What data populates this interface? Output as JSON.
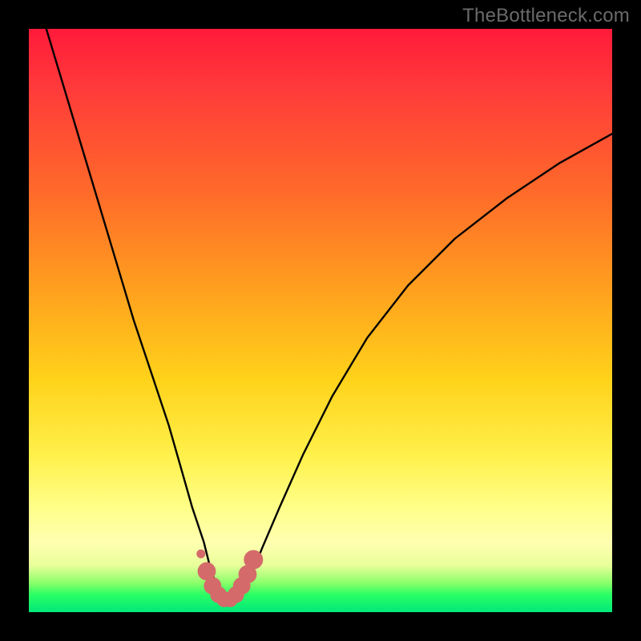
{
  "watermark": "TheBottleneck.com",
  "chart_data": {
    "type": "line",
    "title": "",
    "xlabel": "",
    "ylabel": "",
    "xlim": [
      0,
      100
    ],
    "ylim": [
      0,
      100
    ],
    "grid": false,
    "legend": false,
    "series": [
      {
        "name": "bottleneck-curve",
        "color": "#000000",
        "x": [
          3,
          6,
          9,
          12,
          15,
          18,
          21,
          24,
          26,
          28,
          30,
          31,
          32,
          33,
          34,
          35,
          36,
          38,
          40,
          43,
          47,
          52,
          58,
          65,
          73,
          82,
          91,
          100
        ],
        "values": [
          100,
          90,
          80,
          70,
          60,
          50,
          41,
          32,
          25,
          18,
          12,
          8,
          5,
          3,
          2,
          2,
          3,
          6,
          11,
          18,
          27,
          37,
          47,
          56,
          64,
          71,
          77,
          82
        ]
      },
      {
        "name": "highlight-dots",
        "color": "#d46a6a",
        "x": [
          29.5,
          30.5,
          31.5,
          32.5,
          33.5,
          34.5,
          35.5,
          36.5,
          37.5,
          38.5
        ],
        "values": [
          10,
          7,
          4.5,
          3,
          2.2,
          2.2,
          3,
          4.5,
          6.5,
          9
        ]
      }
    ],
    "background_gradient_stops": [
      {
        "pos": 0.0,
        "color": "#ff1a3a"
      },
      {
        "pos": 0.45,
        "color": "#ffa11e"
      },
      {
        "pos": 0.73,
        "color": "#fff04a"
      },
      {
        "pos": 0.95,
        "color": "#8aff6a"
      },
      {
        "pos": 1.0,
        "color": "#00e87a"
      }
    ]
  }
}
